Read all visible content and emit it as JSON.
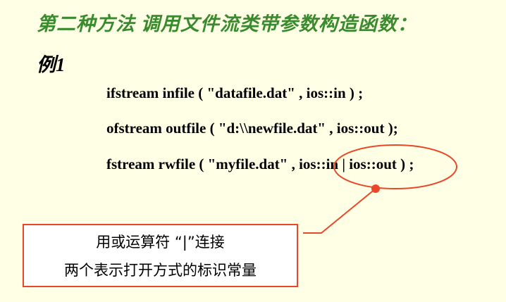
{
  "slide": {
    "title": "第二种方法  调用文件流类带参数构造函数：",
    "example_label": "例1",
    "code_lines": [
      "ifstream infile ( \"datafile.dat\" , ios::in ) ;",
      "ofstream outfile ( \"d:\\\\newfile.dat\" , ios::out );",
      "fstream rwfile ( \"myfile.dat\" , ios::in | ios::out ) ;"
    ],
    "callout": {
      "line1": "用或运算符  “|”连接",
      "line2": "两个表示打开方式的标识常量"
    }
  },
  "colors": {
    "background": "#FFFFE5",
    "title": "#3A8A2E",
    "annotation": "#E8472A"
  }
}
